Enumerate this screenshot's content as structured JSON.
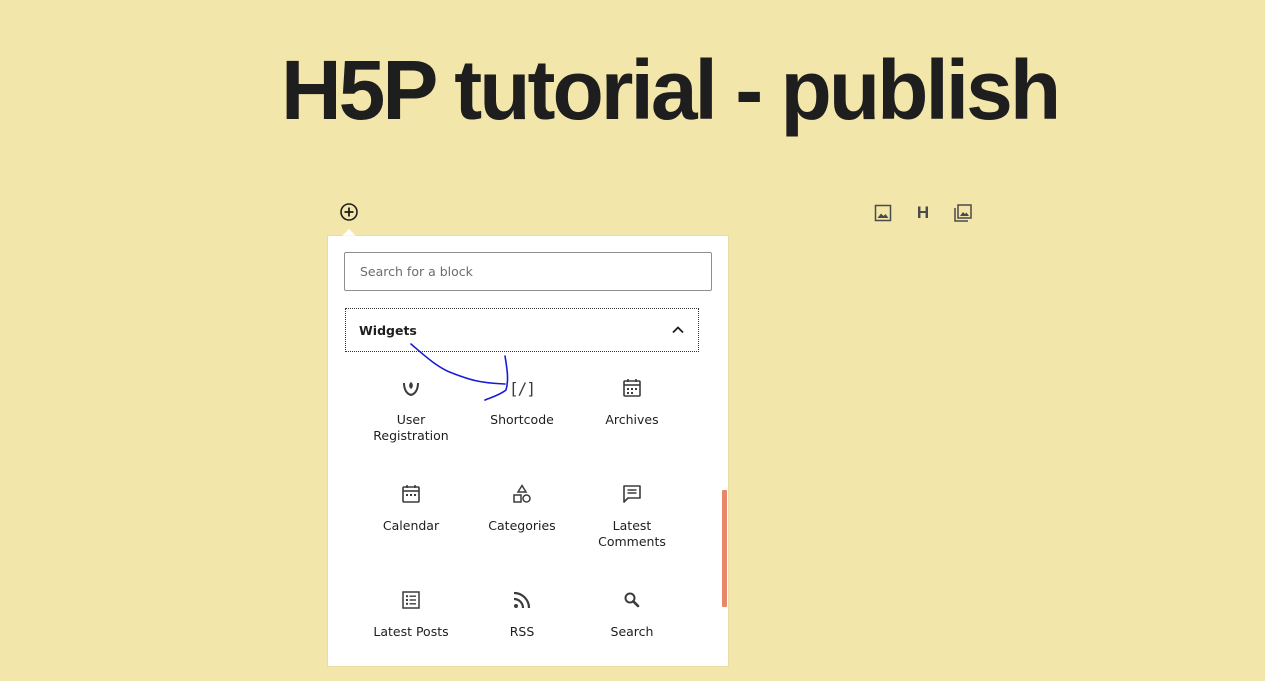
{
  "post": {
    "title": "H5P tutorial - publish"
  },
  "toolbar": {
    "inserter_icon": "plus-circle-icon",
    "quick_tools": [
      "image-icon",
      "heading-icon",
      "gallery-icon"
    ],
    "heading_glyph": "H"
  },
  "inserter": {
    "search": {
      "placeholder": "Search for a block",
      "value": ""
    },
    "panel": {
      "title": "Widgets",
      "expanded": true
    },
    "blocks": [
      {
        "label": "User Registration",
        "icon": "user-registration-icon"
      },
      {
        "label": "Shortcode",
        "icon": "shortcode-icon"
      },
      {
        "label": "Archives",
        "icon": "archives-icon"
      },
      {
        "label": "Calendar",
        "icon": "calendar-icon"
      },
      {
        "label": "Categories",
        "icon": "categories-icon"
      },
      {
        "label": "Latest Comments",
        "icon": "latest-comments-icon"
      },
      {
        "label": "Latest Posts",
        "icon": "latest-posts-icon"
      },
      {
        "label": "RSS",
        "icon": "rss-icon"
      },
      {
        "label": "Search",
        "icon": "search-icon"
      }
    ],
    "shortcode_glyph": "[/]"
  },
  "colors": {
    "page_background": "#f3e6ab",
    "scroll_thumb": "#e8856a",
    "annotation_stroke": "#1a1ad6"
  }
}
